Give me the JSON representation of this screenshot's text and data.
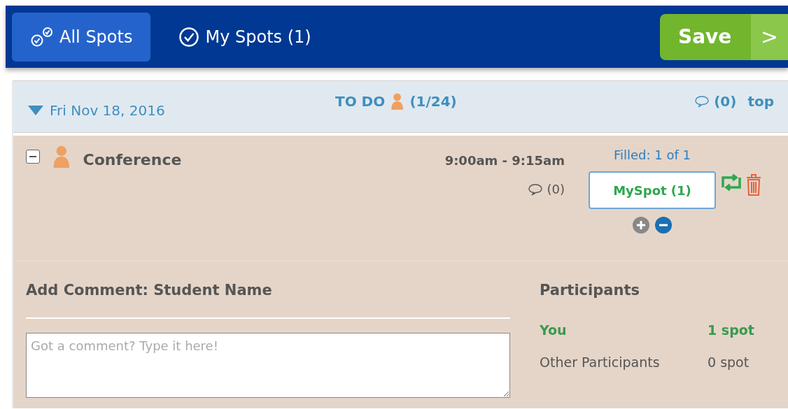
{
  "tabs": [
    {
      "label": "All Spots",
      "selected": true,
      "kind": "double-check"
    },
    {
      "label": "My Spots (1)",
      "selected": false,
      "kind": "check"
    }
  ],
  "save_button": {
    "label": "Save",
    "arrow": ">"
  },
  "date_header": {
    "expanded": true,
    "date": "Fri Nov 18, 2016",
    "todo_label": "TO DO",
    "todo_count": "(1/24)",
    "comments": "(0)",
    "top_link": "top"
  },
  "slot": {
    "expanded": true,
    "title": "Conference",
    "time": "9:00am - 9:15am",
    "comments": "(0)",
    "filled": "Filled: 1 of 1",
    "spot_button": "MySpot (1)"
  },
  "comment_form": {
    "title": "Add Comment: Student Name",
    "placeholder": "Got a comment? Type it here!"
  },
  "participants": {
    "title": "Participants",
    "rows": [
      {
        "kind": "you",
        "name": "You",
        "spots": "1 spot"
      },
      {
        "kind": "other",
        "name": "Other Participants",
        "spots": "0 spot"
      }
    ]
  }
}
